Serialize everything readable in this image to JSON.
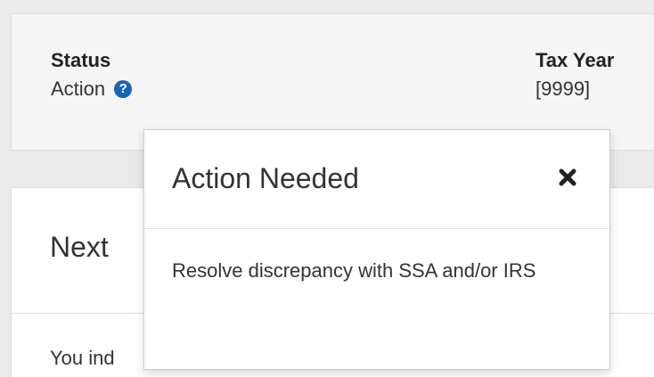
{
  "status_card": {
    "status_heading": "Status",
    "status_value": "Action",
    "help_icon": "question-circle-icon",
    "tax_year_heading": "Tax Year",
    "tax_year_value": "[9999]"
  },
  "next_card": {
    "title": "Next",
    "body_text": "You ind"
  },
  "popover": {
    "title": "Action Needed",
    "close_icon": "close-icon",
    "body": "Resolve discrepancy with SSA and/or IRS"
  },
  "colors": {
    "help_icon": "#1a63b8",
    "page_background": "#eaeaea",
    "card_background": "#f5f5f5"
  }
}
